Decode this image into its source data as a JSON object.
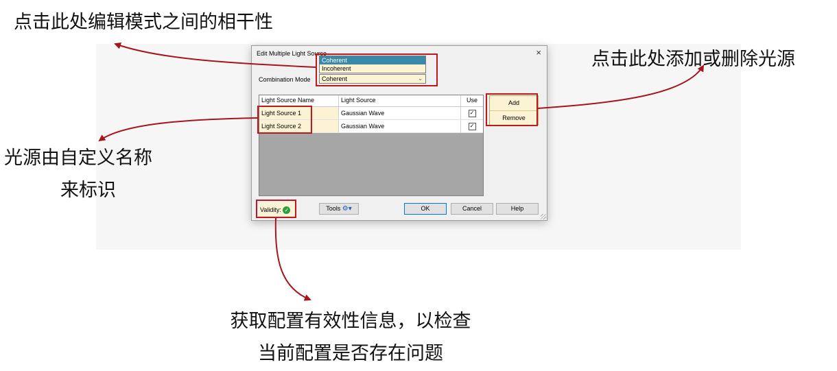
{
  "annotations": {
    "coherence": "点击此处编辑模式之间的相干性",
    "add_remove": "点击此处添加或删除光源",
    "naming_line1": "光源由自定义名称",
    "naming_line2": "来标识",
    "validity_line1": "获取配置有效性信息，以检查",
    "validity_line2": "当前配置是否存在问题"
  },
  "dialog": {
    "title": "Edit Multiple Light Source",
    "close": "×",
    "combination_mode_label": "Combination Mode",
    "combination_mode_value": "Coherent",
    "dropdown_options": [
      "Coherent",
      "Incoherent"
    ],
    "table": {
      "headers": [
        "Light Source Name",
        "Light Source",
        "Use"
      ],
      "rows": [
        {
          "name": "Light Source 1",
          "source": "Gaussian Wave",
          "use": true
        },
        {
          "name": "Light Source 2",
          "source": "Gaussian Wave",
          "use": true
        }
      ]
    },
    "add_label": "Add",
    "remove_label": "Remove",
    "validity_label": "Validity:",
    "tools_label": "Tools",
    "ok_label": "OK",
    "cancel_label": "Cancel",
    "help_label": "Help"
  },
  "colors": {
    "highlight": "#c0161e",
    "field_highlight": "#fbf3d4",
    "selected_option": "#3a89a8"
  }
}
